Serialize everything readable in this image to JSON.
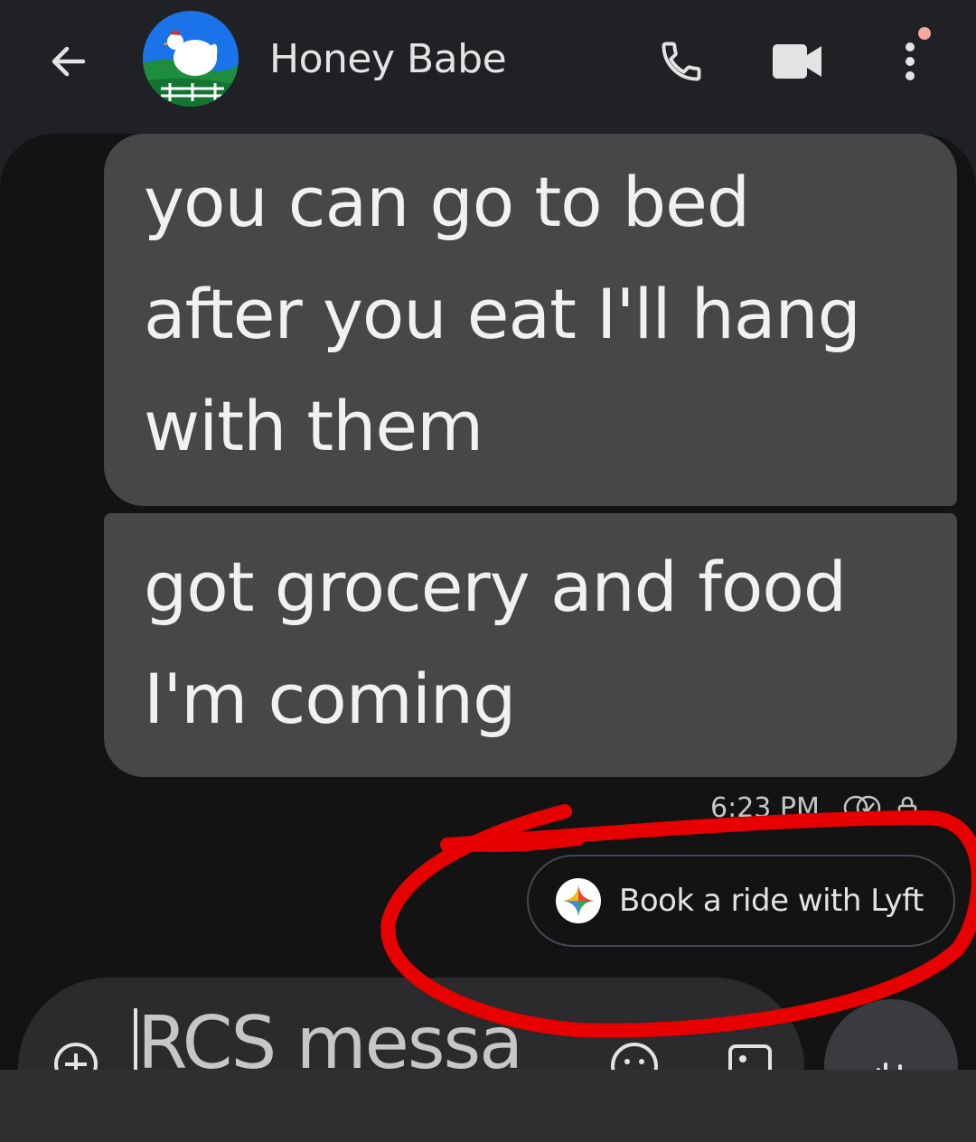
{
  "header": {
    "contact_name": "Honey Babe",
    "icons": {
      "back": "arrow-left-icon",
      "call": "phone-icon",
      "video": "video-camera-icon",
      "more": "more-vertical-icon"
    }
  },
  "messages": [
    {
      "text_lines": [
        "you can go to bed",
        "after you eat I'll hang",
        "with them"
      ]
    },
    {
      "text_lines": [
        "got grocery and food",
        "I'm coming"
      ]
    }
  ],
  "meta": {
    "time": "6:23 PM"
  },
  "suggestion": {
    "label": "Book a ride with Lyft"
  },
  "compose": {
    "placeholder": "RCS messa"
  },
  "colors": {
    "background": "#131314",
    "bubble": "#474747",
    "annotation": "#e60000",
    "notification_dot": "#f4a7a0"
  }
}
